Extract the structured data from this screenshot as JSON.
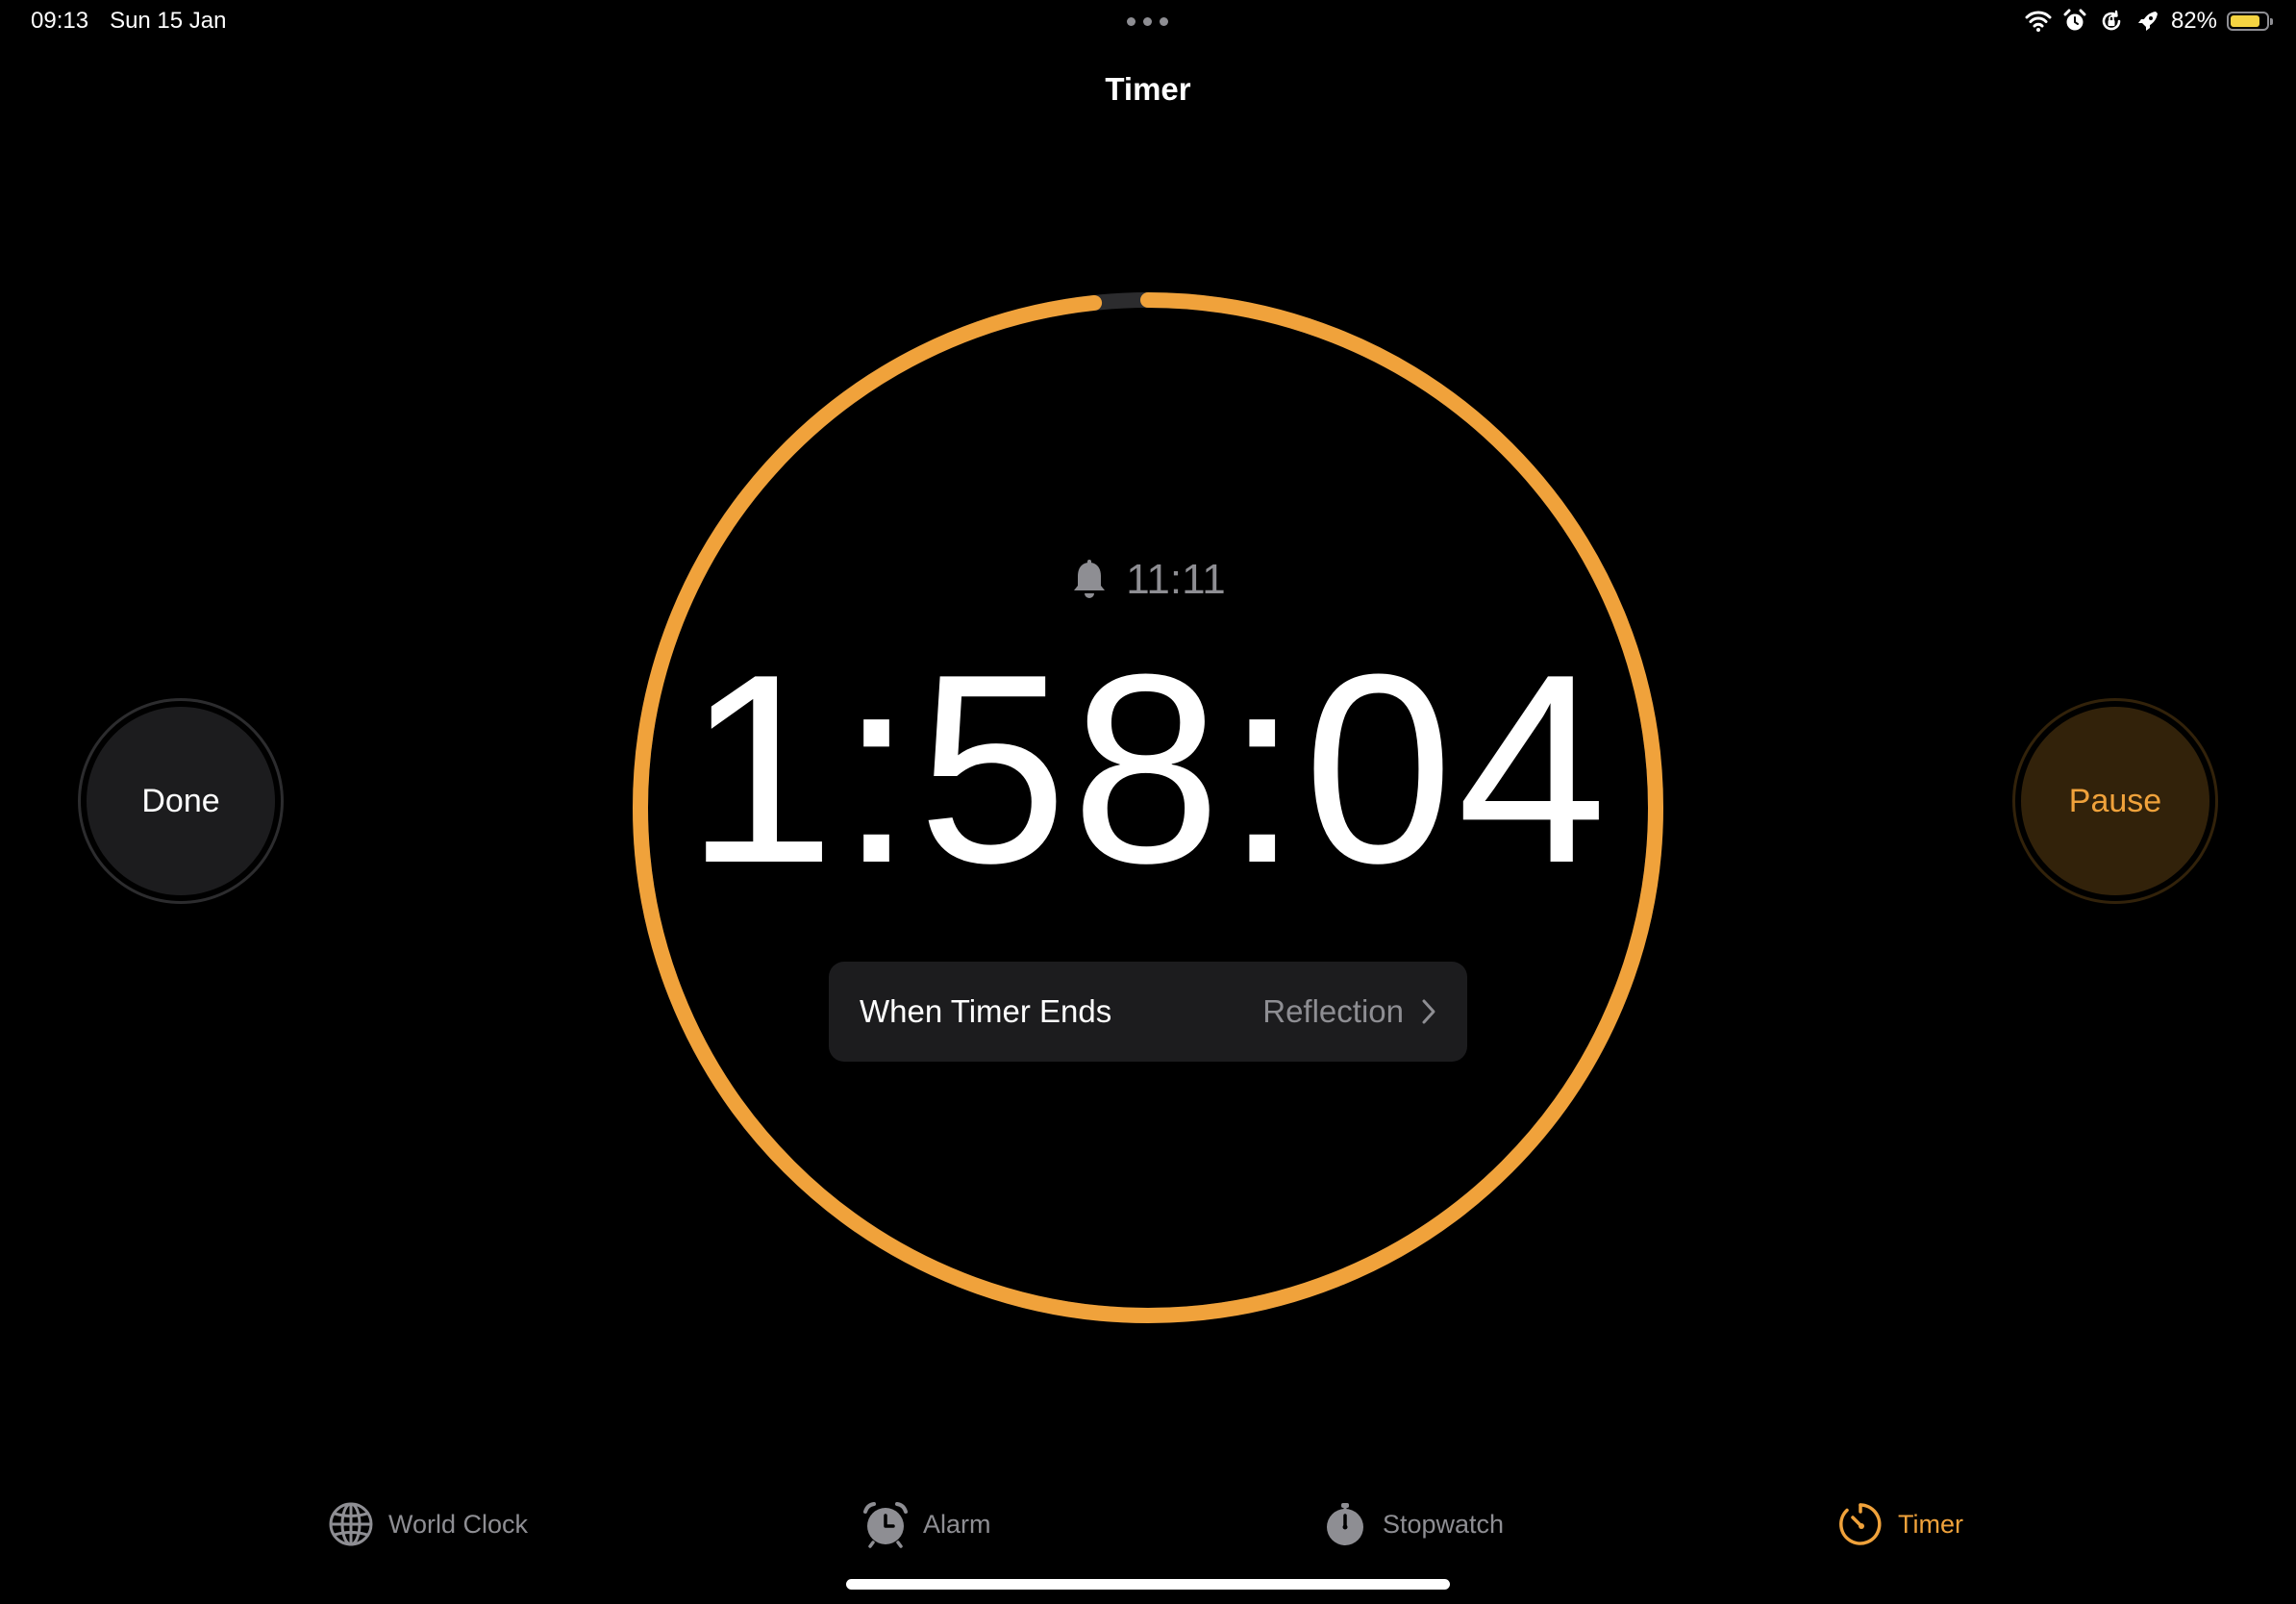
{
  "status_bar": {
    "time": "09:13",
    "date": "Sun 15 Jan",
    "battery_percent": "82%",
    "battery_level": 0.82,
    "icons": [
      "wifi-icon",
      "alarm-icon",
      "screen-lock-icon",
      "rocket-icon",
      "battery-icon"
    ]
  },
  "header": {
    "title": "Timer"
  },
  "timer": {
    "ends_at": "11:11",
    "remaining": "1:58:04",
    "progress_remaining": 0.983,
    "accent_color": "#F0A23B",
    "track_color": "#2C2C2E"
  },
  "sound_row": {
    "label": "When Timer Ends",
    "value": "Reflection"
  },
  "buttons": {
    "done": "Done",
    "pause": "Pause"
  },
  "tabs": [
    {
      "label": "World Clock",
      "icon": "globe-icon",
      "active": false
    },
    {
      "label": "Alarm",
      "icon": "alarm-clock-icon",
      "active": false
    },
    {
      "label": "Stopwatch",
      "icon": "stopwatch-icon",
      "active": false
    },
    {
      "label": "Timer",
      "icon": "timer-icon",
      "active": true
    }
  ]
}
